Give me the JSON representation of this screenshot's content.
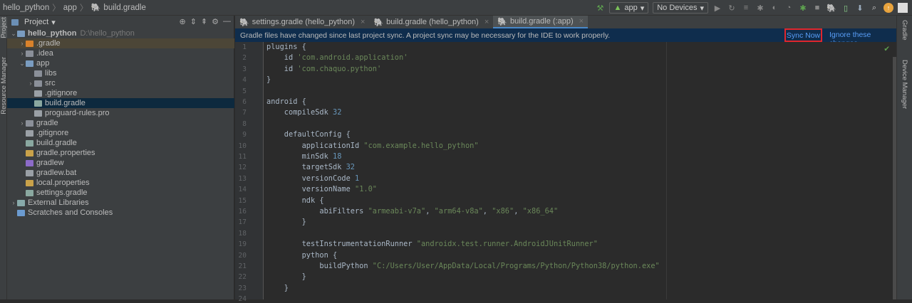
{
  "breadcrumb": [
    "hello_python",
    "app",
    "build.gradle"
  ],
  "toolbar": {
    "run_config": "app",
    "device": "No Devices"
  },
  "left_strip": {
    "project": "Project",
    "resource_manager": "Resource Manager"
  },
  "project_panel": {
    "title": "Project",
    "tree": [
      {
        "label": "hello_python",
        "hint": "D:\\hello_python",
        "depth": 0,
        "arrow": "v",
        "icon": "module-folder"
      },
      {
        "label": ".gradle",
        "depth": 1,
        "arrow": ">",
        "icon": "orange-folder",
        "highlight": true
      },
      {
        "label": ".idea",
        "depth": 1,
        "arrow": ">",
        "icon": "folder"
      },
      {
        "label": "app",
        "depth": 1,
        "arrow": "v",
        "icon": "module-folder"
      },
      {
        "label": "libs",
        "depth": 2,
        "arrow": "",
        "icon": "folder"
      },
      {
        "label": "src",
        "depth": 2,
        "arrow": ">",
        "icon": "folder"
      },
      {
        "label": ".gitignore",
        "depth": 2,
        "arrow": "",
        "icon": "file"
      },
      {
        "label": "build.gradle",
        "depth": 2,
        "arrow": "",
        "icon": "gradle",
        "selected": true
      },
      {
        "label": "proguard-rules.pro",
        "depth": 2,
        "arrow": "",
        "icon": "file"
      },
      {
        "label": "gradle",
        "depth": 1,
        "arrow": ">",
        "icon": "folder"
      },
      {
        "label": ".gitignore",
        "depth": 1,
        "arrow": "",
        "icon": "file"
      },
      {
        "label": "build.gradle",
        "depth": 1,
        "arrow": "",
        "icon": "gradle"
      },
      {
        "label": "gradle.properties",
        "depth": 1,
        "arrow": "",
        "icon": "properties"
      },
      {
        "label": "gradlew",
        "depth": 1,
        "arrow": "",
        "icon": "script"
      },
      {
        "label": "gradlew.bat",
        "depth": 1,
        "arrow": "",
        "icon": "file"
      },
      {
        "label": "local.properties",
        "depth": 1,
        "arrow": "",
        "icon": "properties"
      },
      {
        "label": "settings.gradle",
        "depth": 1,
        "arrow": "",
        "icon": "gradle"
      },
      {
        "label": "External Libraries",
        "depth": 0,
        "arrow": ">",
        "icon": "libraries"
      },
      {
        "label": "Scratches and Consoles",
        "depth": 0,
        "arrow": "",
        "icon": "scratches"
      }
    ]
  },
  "tabs": [
    {
      "label": "settings.gradle (hello_python)",
      "active": false
    },
    {
      "label": "build.gradle (hello_python)",
      "active": false
    },
    {
      "label": "build.gradle (:app)",
      "active": true
    }
  ],
  "notification": {
    "message": "Gradle files have changed since last project sync. A project sync may be necessary for the IDE to work properly.",
    "sync_now": "Sync Now",
    "ignore": "Ignore these changes"
  },
  "code": [
    [
      [
        "kw",
        "plugins {"
      ]
    ],
    [
      [
        "kw",
        "    id "
      ],
      [
        "str",
        "'com.android.application'"
      ]
    ],
    [
      [
        "kw",
        "    id "
      ],
      [
        "str",
        "'com.chaquo.python'"
      ]
    ],
    [
      [
        "kw",
        "}"
      ]
    ],
    [],
    [
      [
        "kw",
        "android {"
      ]
    ],
    [
      [
        "kw",
        "    compileSdk "
      ],
      [
        "num",
        "32"
      ]
    ],
    [],
    [
      [
        "kw",
        "    defaultConfig {"
      ]
    ],
    [
      [
        "kw",
        "        applicationId "
      ],
      [
        "str",
        "\"com.example.hello_python\""
      ]
    ],
    [
      [
        "kw",
        "        minSdk "
      ],
      [
        "num",
        "18"
      ]
    ],
    [
      [
        "kw",
        "        targetSdk "
      ],
      [
        "num",
        "32"
      ]
    ],
    [
      [
        "kw",
        "        versionCode "
      ],
      [
        "num",
        "1"
      ]
    ],
    [
      [
        "kw",
        "        versionName "
      ],
      [
        "str",
        "\"1.0\""
      ]
    ],
    [
      [
        "kw",
        "        ndk {"
      ]
    ],
    [
      [
        "kw",
        "            abiFilters "
      ],
      [
        "str",
        "\"armeabi-v7a\""
      ],
      [
        "kw",
        ", "
      ],
      [
        "str",
        "\"arm64-v8a\""
      ],
      [
        "kw",
        ", "
      ],
      [
        "str",
        "\"x86\""
      ],
      [
        "kw",
        ", "
      ],
      [
        "str",
        "\"x86_64\""
      ]
    ],
    [
      [
        "kw",
        "        }"
      ]
    ],
    [],
    [
      [
        "kw",
        "        testInstrumentationRunner "
      ],
      [
        "str",
        "\"androidx.test.runner.AndroidJUnitRunner\""
      ]
    ],
    [
      [
        "kw",
        "        python {"
      ]
    ],
    [
      [
        "kw",
        "            buildPython "
      ],
      [
        "str",
        "\"C:/Users/User/AppData/Local/Programs/Python/Python38/python.exe\""
      ]
    ],
    [
      [
        "kw",
        "        }"
      ]
    ],
    [
      [
        "kw",
        "    }"
      ]
    ],
    []
  ],
  "right_strip": {
    "gradle": "Gradle",
    "device_manager": "Device Manager"
  },
  "colors": {
    "accent": "#4a88c7",
    "highlight_box": "#e0262d",
    "link": "#589df6",
    "notification_bg": "#0f2d4d"
  }
}
